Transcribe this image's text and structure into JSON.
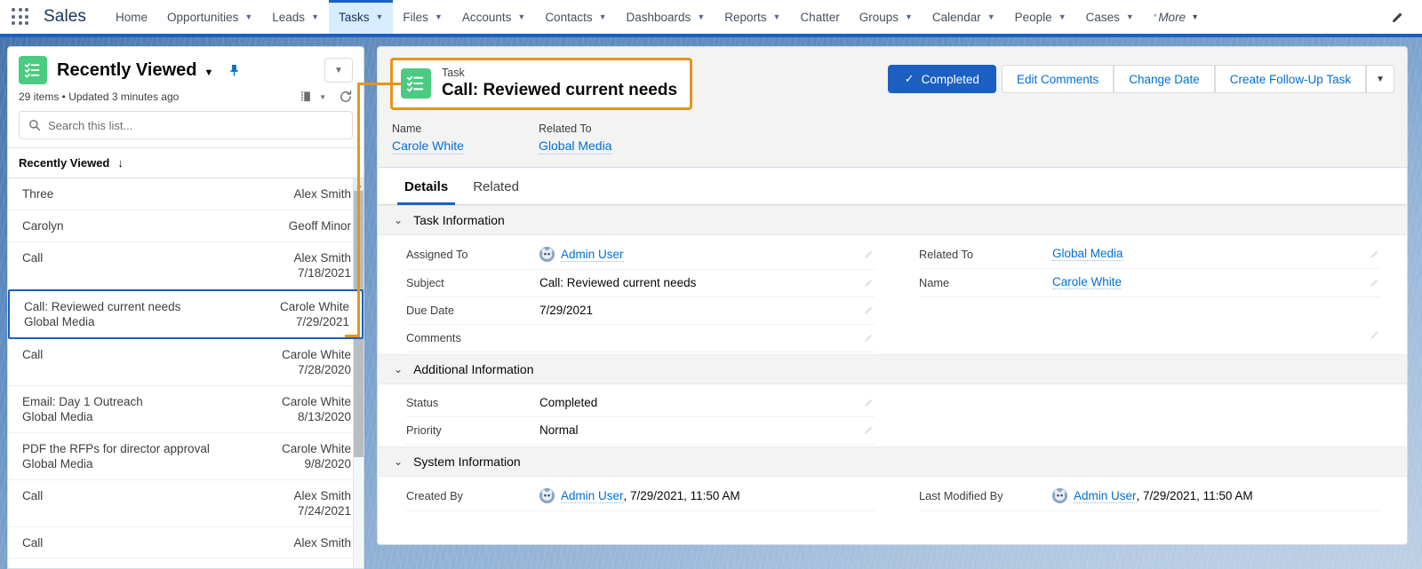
{
  "topnav": {
    "app_launcher_icon": "waffle-grid-icon",
    "app_name": "Sales",
    "edit_icon": "pencil-icon",
    "items": [
      {
        "label": "Home",
        "has_caret": false,
        "active": false
      },
      {
        "label": "Opportunities",
        "has_caret": true,
        "active": false
      },
      {
        "label": "Leads",
        "has_caret": true,
        "active": false
      },
      {
        "label": "Tasks",
        "has_caret": true,
        "active": true
      },
      {
        "label": "Files",
        "has_caret": true,
        "active": false
      },
      {
        "label": "Accounts",
        "has_caret": true,
        "active": false
      },
      {
        "label": "Contacts",
        "has_caret": true,
        "active": false
      },
      {
        "label": "Dashboards",
        "has_caret": true,
        "active": false
      },
      {
        "label": "Reports",
        "has_caret": true,
        "active": false
      },
      {
        "label": "Chatter",
        "has_caret": false,
        "active": false
      },
      {
        "label": "Groups",
        "has_caret": true,
        "active": false
      },
      {
        "label": "Calendar",
        "has_caret": true,
        "active": false
      },
      {
        "label": "People",
        "has_caret": true,
        "active": false
      },
      {
        "label": "Cases",
        "has_caret": true,
        "active": false
      }
    ],
    "more_label": "More"
  },
  "listpanel": {
    "icon": "task-list-icon",
    "title": "Recently Viewed",
    "title_caret": "▼",
    "pin_icon": "pin-icon",
    "menu_caret": "▼",
    "subtitle": "29 items • Updated 3 minutes ago",
    "display_icon": "display-density-icon",
    "refresh_icon": "refresh-icon",
    "search_placeholder": "Search this list...",
    "search_value": "",
    "search_icon": "search-icon",
    "column_header": "Recently Viewed",
    "sort_arrow": "↓",
    "rows": [
      {
        "title": "Three",
        "sub": "",
        "owner": "Alex Smith",
        "date": "",
        "selected": false
      },
      {
        "title": "Carolyn",
        "sub": "",
        "owner": "Geoff Minor",
        "date": "",
        "selected": false
      },
      {
        "title": "Call",
        "sub": "",
        "owner": "Alex Smith",
        "date": "7/18/2021",
        "selected": false
      },
      {
        "title": "Call: Reviewed current needs",
        "sub": "Global Media",
        "owner": "Carole White",
        "date": "7/29/2021",
        "selected": true
      },
      {
        "title": "Call",
        "sub": "",
        "owner": "Carole White",
        "date": "7/28/2020",
        "selected": false
      },
      {
        "title": "Email: Day 1 Outreach",
        "sub": "Global Media",
        "owner": "Carole White",
        "date": "8/13/2020",
        "selected": false
      },
      {
        "title": "PDF the RFPs for director approval",
        "sub": "Global Media",
        "owner": "Carole White",
        "date": "9/8/2020",
        "selected": false
      },
      {
        "title": "Call",
        "sub": "",
        "owner": "Alex Smith",
        "date": "7/24/2021",
        "selected": false
      },
      {
        "title": "Call",
        "sub": "",
        "owner": "Alex Smith",
        "date": "",
        "selected": false
      }
    ]
  },
  "record": {
    "object_label": "Task",
    "title": "Call: Reviewed current needs",
    "icon": "task-list-icon",
    "highlight_color": "#e8941a",
    "header_fields": [
      {
        "label": "Name",
        "value": "Carole White"
      },
      {
        "label": "Related To",
        "value": "Global Media"
      }
    ],
    "actions": {
      "primary": {
        "label": "Completed",
        "check_icon": "check-icon"
      },
      "buttons": [
        "Edit Comments",
        "Change Date",
        "Create Follow-Up Task"
      ],
      "overflow_caret": "▼"
    },
    "tabs": [
      {
        "label": "Details",
        "active": true
      },
      {
        "label": "Related",
        "active": false
      }
    ],
    "sections": [
      {
        "name": "Task Information",
        "chevron": "⌄",
        "left_fields": [
          {
            "label": "Assigned To",
            "value": "Admin User",
            "type": "user-link",
            "editable": true
          },
          {
            "label": "Subject",
            "value": "Call: Reviewed current needs",
            "type": "text",
            "editable": true
          },
          {
            "label": "Due Date",
            "value": "7/29/2021",
            "type": "text",
            "editable": true
          },
          {
            "label": "Comments",
            "value": "",
            "type": "text",
            "editable": true
          }
        ],
        "right_fields": [
          {
            "label": "Related To",
            "value": "Global Media",
            "type": "link",
            "editable": true
          },
          {
            "label": "Name",
            "value": "Carole White",
            "type": "link",
            "editable": true
          }
        ]
      },
      {
        "name": "Additional Information",
        "chevron": "⌄",
        "left_fields": [
          {
            "label": "Status",
            "value": "Completed",
            "type": "text",
            "editable": true
          },
          {
            "label": "Priority",
            "value": "Normal",
            "type": "text",
            "editable": true
          }
        ],
        "right_fields": []
      },
      {
        "name": "System Information",
        "chevron": "⌄",
        "left_fields": [
          {
            "label": "Created By",
            "value": "Admin User",
            "meta": ", 7/29/2021, 11:50 AM",
            "type": "user-link",
            "editable": false
          }
        ],
        "right_fields": [
          {
            "label": "Last Modified By",
            "value": "Admin User",
            "meta": ", 7/29/2021, 11:50 AM",
            "type": "user-link",
            "editable": false
          }
        ]
      }
    ]
  },
  "colors": {
    "brand_blue": "#1b5fc1",
    "link_blue": "#0070d2",
    "task_green": "#4bca81",
    "highlight_orange": "#e8941a",
    "active_tab_bg": "#d8edff"
  }
}
